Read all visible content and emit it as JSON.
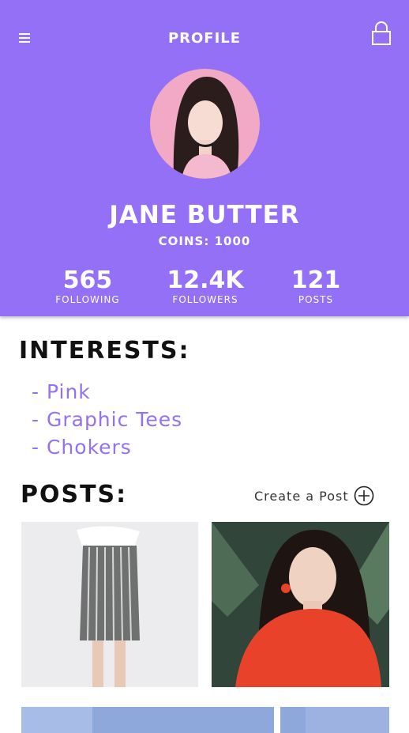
{
  "header": {
    "title": "PROFILE",
    "menu_icon": "hamburger-menu-icon",
    "lock_icon": "lock-icon",
    "background_color": "#9370f5"
  },
  "profile": {
    "name": "JANE BUTTER",
    "coins": "COINS: 1000"
  },
  "stats": [
    {
      "value": "565",
      "label": "FOLLOWING"
    },
    {
      "value": "12.4K",
      "label": "FOLLOWERS"
    },
    {
      "value": "121",
      "label": "POSTS"
    }
  ],
  "interests": {
    "heading": "INTERESTS:",
    "items": [
      "- Pink",
      "- Graphic Tees",
      "- Chokers"
    ],
    "color": "#9370f5"
  },
  "posts": {
    "heading": "POSTS:",
    "create_label": "Create a Post",
    "create_icon": "plus-circle-icon"
  }
}
